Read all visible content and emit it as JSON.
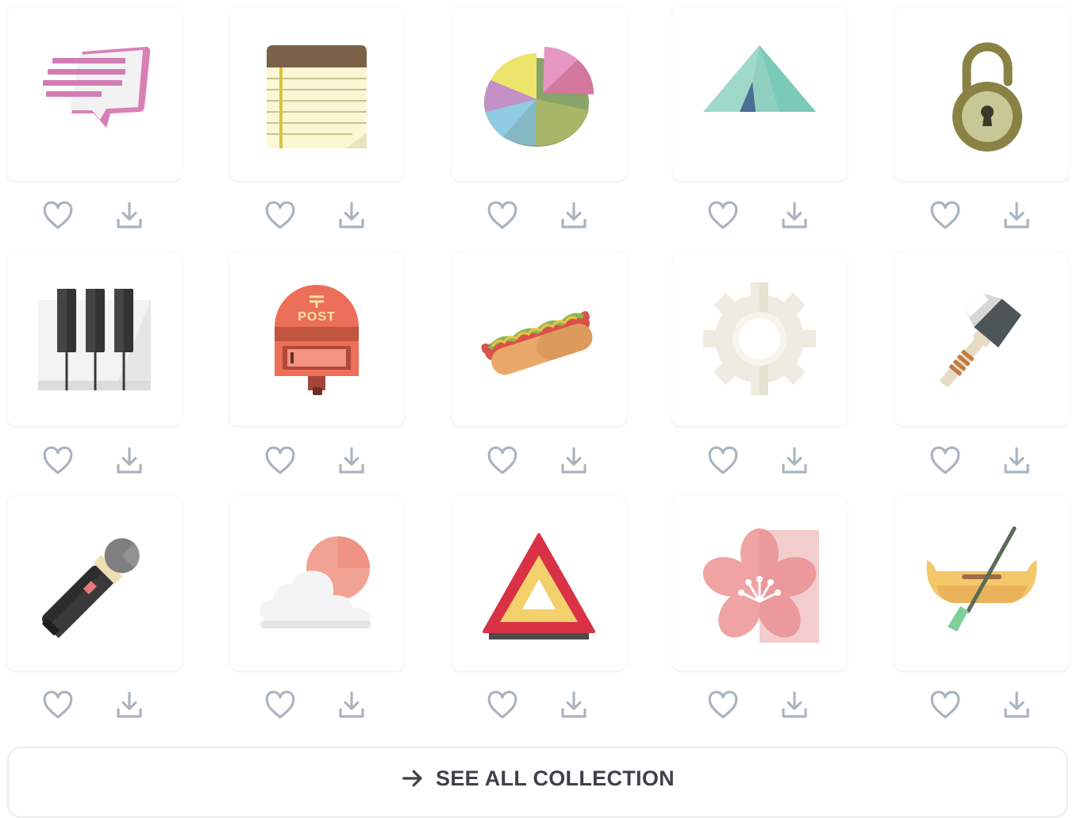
{
  "icons": [
    {
      "name": "chat-bubble-icon"
    },
    {
      "name": "notepad-icon"
    },
    {
      "name": "pie-chart-icon"
    },
    {
      "name": "tent-icon"
    },
    {
      "name": "padlock-icon"
    },
    {
      "name": "piano-keys-icon"
    },
    {
      "name": "post-box-icon"
    },
    {
      "name": "hot-dog-icon"
    },
    {
      "name": "gear-icon"
    },
    {
      "name": "axe-icon"
    },
    {
      "name": "microphone-icon"
    },
    {
      "name": "cloud-sun-icon"
    },
    {
      "name": "warning-triangle-icon"
    },
    {
      "name": "cherry-blossom-icon"
    },
    {
      "name": "canoe-icon"
    }
  ],
  "actions": {
    "like_icon": "heart-icon",
    "download_icon": "download-icon"
  },
  "see_all": {
    "label": "SEE ALL COLLECTION",
    "icon": "arrow-right-icon"
  },
  "colors": {
    "action_icon": "#a9b4c0",
    "button_text": "#3d4249",
    "button_border": "#ececec"
  }
}
